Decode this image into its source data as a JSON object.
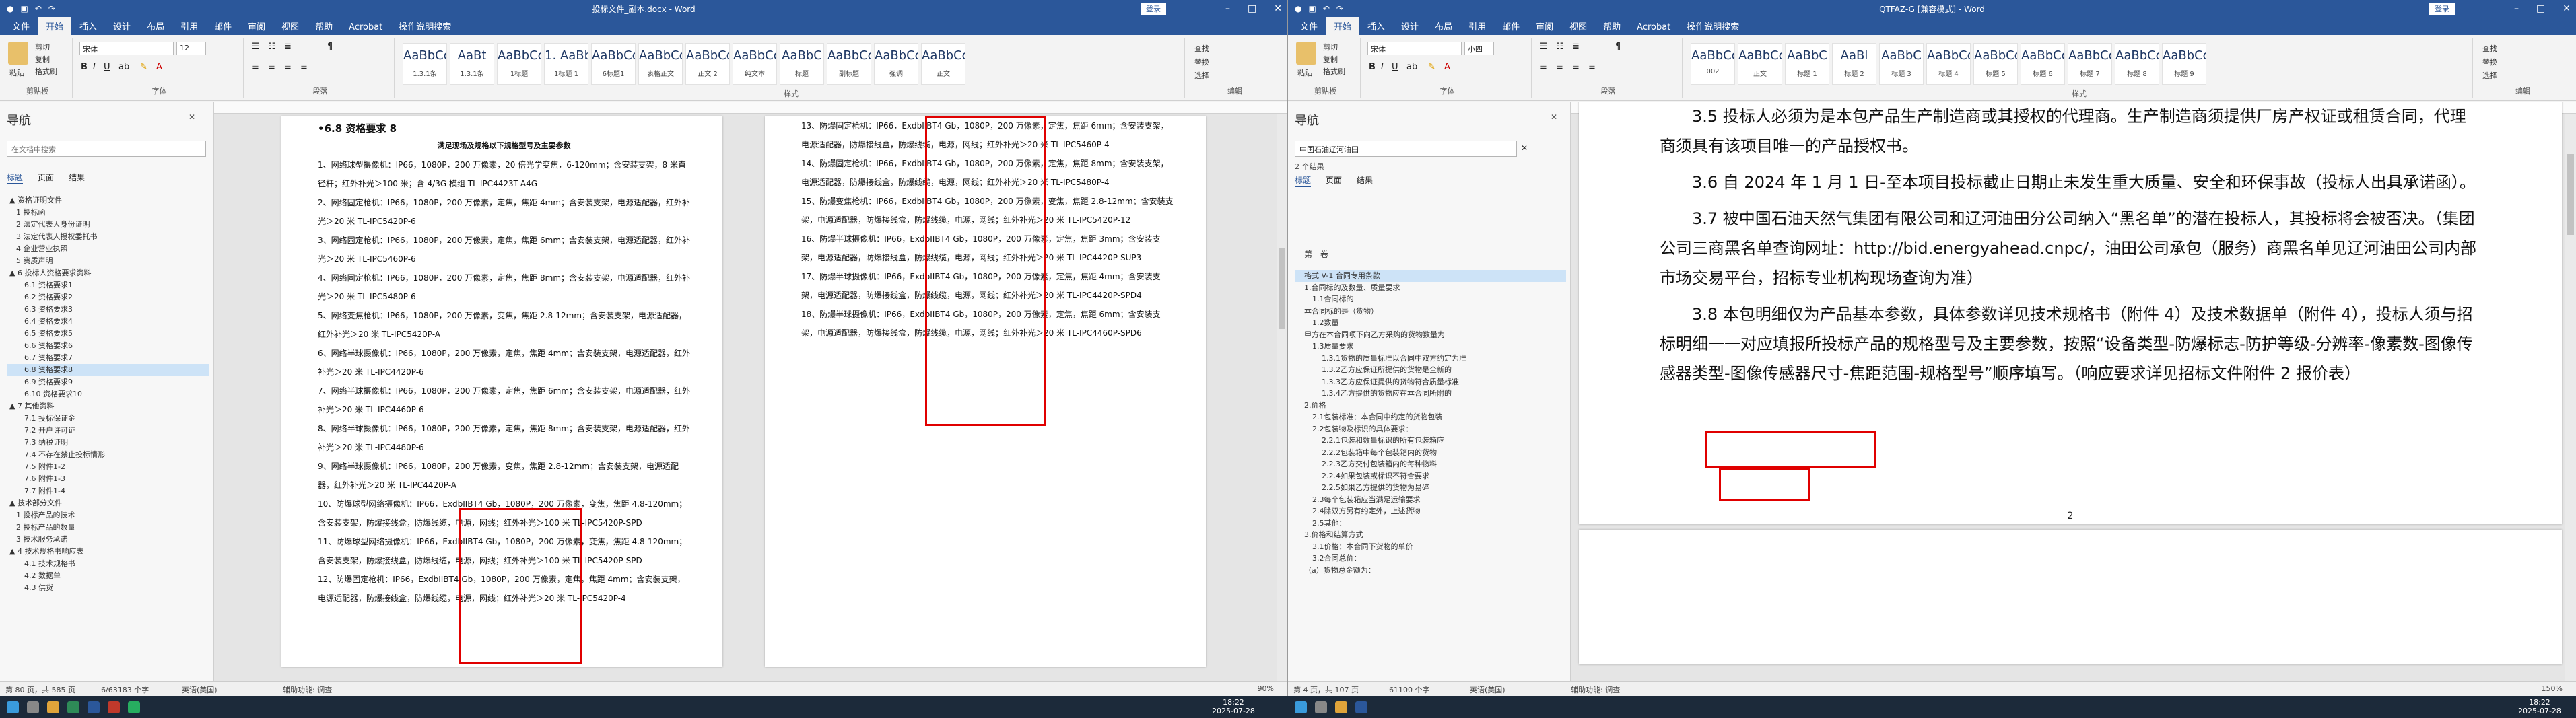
{
  "left": {
    "title": "投标文件_副本.docx - Word",
    "account": "登录",
    "tabs": [
      "文件",
      "开始",
      "插入",
      "设计",
      "布局",
      "引用",
      "邮件",
      "审阅",
      "视图",
      "帮助",
      "Acrobat",
      "操作说明搜索"
    ],
    "active_tab": "开始",
    "clipboard": {
      "paste": "粘贴",
      "cut": "剪切",
      "copy": "复制",
      "painter": "格式刷",
      "label": "剪贴板"
    },
    "font": {
      "name": "宋体",
      "size": "12",
      "label": "字体"
    },
    "paragraph_label": "段落",
    "styles_label": "样式",
    "editing": {
      "find": "查找",
      "replace": "替换",
      "select": "选择",
      "label": "编辑"
    },
    "styles": [
      {
        "sample": "AaBbCcI",
        "name": "1.3.1条"
      },
      {
        "sample": "AaBt",
        "name": "1.3.1条"
      },
      {
        "sample": "AaBbCcD",
        "name": "1标题"
      },
      {
        "sample": "1. AaBb",
        "name": "1标题 1"
      },
      {
        "sample": "AaBbCcC",
        "name": "6标题1"
      },
      {
        "sample": "AaBbCcD",
        "name": "表格正文"
      },
      {
        "sample": "AaBbCcD",
        "name": "正文 2"
      },
      {
        "sample": "AaBbCcDd",
        "name": "纯文本"
      },
      {
        "sample": "AaBbC",
        "name": "标题"
      },
      {
        "sample": "AaBbCc",
        "name": "副标题"
      },
      {
        "sample": "AaBbCc",
        "name": "强调"
      },
      {
        "sample": "AaBbCcD",
        "name": "正文"
      }
    ],
    "nav": {
      "title": "导航",
      "search_placeholder": "在文档中搜索",
      "tabs": [
        "标题",
        "页面",
        "结果"
      ],
      "items": [
        "▲ 资格证明文件",
        "1 投标函",
        "2 法定代表人身份证明",
        "3 法定代表人授权委托书",
        "4 企业营业执照",
        "5 资质声明",
        "▲ 6 投标人资格要求资料",
        "6.1 资格要求1",
        "6.2 资格要求2",
        "6.3 资格要求3",
        "6.4 资格要求4",
        "6.5 资格要求5",
        "6.6 资格要求6",
        "6.7 资格要求7",
        "6.8 资格要求8",
        "6.9 资格要求9",
        "6.10 资格要求10",
        "▲ 7 其他资料",
        "7.1 投标保证金",
        "7.2 开户许可证",
        "7.3 纳税证明",
        "7.4 不存在禁止投标情形",
        "7.5 附件1-2",
        "7.6 附件1-3",
        "7.7 附件1-4",
        "▲ 技术部分文件",
        "1 投标产品的技术",
        "2 投标产品的数量",
        "3 技术服务承诺",
        "▲ 4 技术规格书响应表",
        "4.1 技术规格书",
        "4.2 数据单",
        "4.3 供货"
      ],
      "selected": 14
    },
    "page1": {
      "heading": "•6.8   资格要求 8",
      "subheading": "满足现场及规格以下规格型号及主要参数",
      "paras": [
        "1、网络球型摄像机：IP66，1080P，200 万像素，20 倍光学变焦，6-120mm；含安装支架，8 米直径杆；红外补光＞100 米；含 4/3G 模组 TL-IPC4423T-A4G",
        "2、网络固定枪机：IP66，1080P，200 万像素，定焦，焦距 4mm；含安装支架，电源适配器，红外补光＞20 米 TL-IPC5420P-6",
        "3、网络固定枪机：IP66，1080P，200 万像素，定焦，焦距 6mm；含安装支架，电源适配器，红外补光＞20 米 TL-IPC5460P-6",
        "4、网络固定枪机：IP66，1080P，200 万像素，定焦，焦距 8mm；含安装支架，电源适配器，红外补光＞20 米 TL-IPC5480P-6",
        "5、网络变焦枪机：IP66，1080P，200 万像素，变焦，焦距 2.8-12mm；含安装支架，电源适配器，红外补光＞20 米 TL-IPC5420P-A",
        "6、网络半球摄像机：IP66，1080P，200 万像素，定焦，焦距 4mm；含安装支架，电源适配器，红外补光＞20 米 TL-IPC4420P-6",
        "7、网络半球摄像机：IP66，1080P，200 万像素，定焦，焦距 6mm；含安装支架，电源适配器，红外补光＞20 米 TL-IPC4460P-6",
        "8、网络半球摄像机：IP66，1080P，200 万像素，定焦，焦距 8mm；含安装支架，电源适配器，红外补光＞20 米 TL-IPC4480P-6",
        "9、网络半球摄像机：IP66，1080P，200 万像素，变焦，焦距 2.8-12mm；含安装支架，电源适配器，红外补光＞20 米 TL-IPC4420P-A",
        "10、防爆球型网络摄像机：IP66，ExdbIIBT4 Gb，1080P，200 万像素，变焦，焦距 4.8-120mm；含安装支架，防爆接线盒，防爆线缆，电源，网线；红外补光＞100 米 TL-IPC5420P-SPD",
        "11、防爆球型网络摄像机：IP66，ExdbIIBT4 Gb，1080P，200 万像素，变焦，焦距 4.8-120mm；含安装支架，防爆接线盒，防爆线缆，电源，网线；红外补光＞100 米 TL-IPC5420P-SPD",
        "12、防爆固定枪机：IP66，ExdbIIBT4 Gb，1080P，200 万像素，定焦，焦距 4mm；含安装支架，电源适配器，防爆接线盒，防爆线缆，电源，网线；红外补光＞20 米 TL-IPC5420P-4"
      ]
    },
    "page2": {
      "paras": [
        "13、防爆固定枪机：IP66，ExdbIIBT4 Gb，1080P，200 万像素，定焦，焦距 6mm；含安装支架，电源适配器，防爆接线盒，防爆线缆，电源，网线；红外补光＞20 米 TL-IPC5460P-4",
        "14、防爆固定枪机：IP66，ExdbIIBT4 Gb，1080P，200 万像素，定焦，焦距 8mm；含安装支架，电源适配器，防爆接线盒，防爆线缆，电源，网线；红外补光＞20 米 TL-IPC5480P-4",
        "15、防爆变焦枪机：IP66，ExdbIIBT4 Gb，1080P，200 万像素，变焦，焦距 2.8-12mm；含安装支架，电源适配器，防爆接线盒，防爆线缆，电源，网线；红外补光＞20 米 TL-IPC5420P-12",
        "16、防爆半球摄像机：IP66，ExdbIIBT4 Gb，1080P，200 万像素，定焦，焦距 3mm；含安装支架，电源适配器，防爆接线盒，防爆线缆，电源，网线；红外补光＞20 米 TL-IPC4420P-SUP3",
        "17、防爆半球摄像机：IP66，ExdbIIBT4 Gb，1080P，200 万像素，定焦，焦距 4mm；含安装支架，电源适配器，防爆接线盒，防爆线缆，电源，网线；红外补光＞20 米 TL-IPC4420P-SPD4",
        "18、防爆半球摄像机：IP66，ExdbIIBT4 Gb，1080P，200 万像素，定焦，焦距 6mm；含安装支架，电源适配器，防爆接线盒，防爆线缆，电源，网线；红外补光＞20 米 TL-IPC4460P-SPD6"
      ]
    },
    "status": {
      "page": "第 80 页，共 585 页",
      "words": "6/63183 个字",
      "lang": "英语(美国)",
      "focus": "辅助功能: 调查",
      "zoom": "90%"
    }
  },
  "right": {
    "title": "QTFAZ-G [兼容模式] - Word",
    "account": "登录",
    "tabs": [
      "文件",
      "开始",
      "插入",
      "设计",
      "布局",
      "引用",
      "邮件",
      "审阅",
      "视图",
      "帮助",
      "Acrobat",
      "操作说明搜索"
    ],
    "active_tab": "开始",
    "clipboard": {
      "paste": "粘贴",
      "cut": "剪切",
      "copy": "复制",
      "painter": "格式刷",
      "label": "剪贴板"
    },
    "font": {
      "name": "宋体",
      "size": "小四",
      "label": "字体"
    },
    "paragraph_label": "段落",
    "styles_label": "样式",
    "editing": {
      "find": "查找",
      "replace": "替换",
      "select": "选择",
      "label": "编辑"
    },
    "styles": [
      {
        "sample": "AaBbCc",
        "name": "002"
      },
      {
        "sample": "AaBbCcDd",
        "name": "正文"
      },
      {
        "sample": "AaBbC",
        "name": "标题 1"
      },
      {
        "sample": "AaBl",
        "name": "标题 2"
      },
      {
        "sample": "AaBbC",
        "name": "标题 3"
      },
      {
        "sample": "AaBbCc",
        "name": "标题 4"
      },
      {
        "sample": "AaBbCcD",
        "name": "标题 5"
      },
      {
        "sample": "AaBbCcDd",
        "name": "标题 6"
      },
      {
        "sample": "AaBbCcDd",
        "name": "标题 7"
      },
      {
        "sample": "AaBbCcDd",
        "name": "标题 8"
      },
      {
        "sample": "AaBbCcDd",
        "name": "标题 9"
      }
    ],
    "nav": {
      "title": "导航",
      "search_value": "中国石油辽河油田",
      "results": "2 个结果",
      "tabs": [
        "标题",
        "页面",
        "结果"
      ],
      "section": "第一卷",
      "items": [
        "格式 V-1  合同专用条款",
        "1.合同标的及数量、质量要求",
        "1.1合同标的",
        "本合同标的是（货物）",
        "1.2数量",
        "甲方在本合同项下向乙方采购的货物数量为",
        "1.3质量要求",
        "1.3.1货物的质量标准以合同中双方约定为准",
        "1.3.2乙方应保证所提供的货物是全新的",
        "1.3.3乙方应保证提供的货物符合质量标准",
        "1.3.4乙方提供的货物应在本合同所附的",
        "2.价格",
        "2.1包装标准：本合同中约定的货物包装",
        "2.2包装物及标识的具体要求：",
        "2.2.1包装和数量标识的所有包装箱应",
        "2.2.2包装箱中每个包装箱内的货物",
        "2.2.3乙方交付包装箱内的每种物料",
        "2.2.4如果包装或标识不符合要求",
        "2.2.5如果乙方提供的货物为易碎",
        "2.3每个包装箱应当满足运输要求",
        "2.4除双方另有约定外，上述货物",
        "2.5其他：",
        "3.价格和结算方式",
        "3.1价格：本合同下货物的单价",
        "3.2合同总价：",
        "（a）货物总金额为："
      ],
      "selected": 0
    },
    "page": {
      "lines": [
        "3.5 投标人必须为是本包产品生产制造商或其授权的代理商。生产制造商须提供厂房产权证或租赁合同，代理商须具有该项目唯一的产品授权书。",
        "3.6 自 2024 年 1 月 1 日-至本项目投标截止日期止未发生重大质量、安全和环保事故（投标人出具承诺函）。",
        "3.7 被中国石油天然气集团有限公司和辽河油田分公司纳入“黑名单”的潜在投标人，其投标将会被否决。（集团公司三商黑名单查询网址：http://bid.energyahead.cnpc/，油田公司承包（服务）商黑名单见辽河油田公司内部市场交易平台，招标专业机构现场查询为准）",
        "3.8 本包明细仅为产品基本参数，具体参数详见技术规格书（附件 4）及技术数据单（附件 4），投标人须与招标明细一一对应填报所投标产品的规格型号及主要参数，按照“设备类型-防爆标志-防护等级-分辨率-像素数-图像传感器类型-图像传感器尺寸-焦距范围-规格型号”顺序填写。（响应要求详见招标文件附件 2 报价表）"
      ],
      "footer_page": "2"
    },
    "status": {
      "page": "第 4 页，共 107 页",
      "words": "61100 个字",
      "lang": "英语(美国)",
      "focus": "辅助功能: 调查",
      "zoom": "150%"
    }
  },
  "taskbar": {
    "time_left": "18:22",
    "date_left": "2025-07-28",
    "time_right": "18:22",
    "date_right": "2025-07-28"
  },
  "colors": {
    "word_blue": "#2b579a",
    "highlight_red": "#e00000"
  }
}
